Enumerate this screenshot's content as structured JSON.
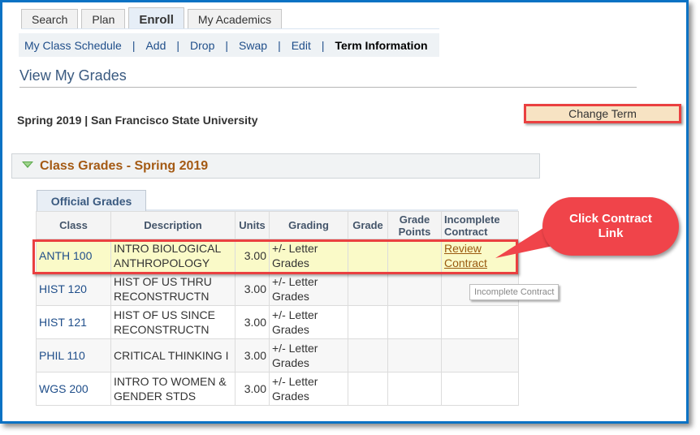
{
  "tabs": [
    {
      "label": "Search",
      "active": false
    },
    {
      "label": "Plan",
      "active": false
    },
    {
      "label": "Enroll",
      "active": true
    },
    {
      "label": "My Academics",
      "active": false
    }
  ],
  "subnav": {
    "items": [
      "My Class Schedule",
      "Add",
      "Drop",
      "Swap",
      "Edit"
    ],
    "separator": "|",
    "current": "Term Information"
  },
  "page_title": "View My Grades",
  "term_line": "Spring 2019 | San Francisco State University",
  "change_term_label": "Change Term",
  "section": {
    "title": "Class Grades - Spring 2019"
  },
  "grid_tab": "Official Grades",
  "table": {
    "headers": [
      "Class",
      "Description",
      "Units",
      "Grading",
      "Grade",
      "Grade Points",
      "Incomplete Contract"
    ],
    "rows": [
      {
        "class": "ANTH 100",
        "description": "INTRO BIOLOGICAL ANTHROPOLOGY",
        "units": "3.00",
        "grading": "+/- Letter Grades",
        "grade": "",
        "grade_points": "",
        "incomplete": "Review Contract"
      },
      {
        "class": "HIST 120",
        "description": "HIST OF US THRU RECONSTRUCTN",
        "units": "3.00",
        "grading": "+/- Letter Grades",
        "grade": "",
        "grade_points": "",
        "incomplete": ""
      },
      {
        "class": "HIST 121",
        "description": "HIST OF US SINCE RECONSTRUCTN",
        "units": "3.00",
        "grading": "+/- Letter Grades",
        "grade": "",
        "grade_points": "",
        "incomplete": ""
      },
      {
        "class": "PHIL 110",
        "description": "CRITICAL THINKING I",
        "units": "3.00",
        "grading": "+/- Letter Grades",
        "grade": "",
        "grade_points": "",
        "incomplete": ""
      },
      {
        "class": "WGS 200",
        "description": "INTRO TO WOMEN & GENDER STDS",
        "units": "3.00",
        "grading": "+/- Letter Grades",
        "grade": "",
        "grade_points": "",
        "incomplete": ""
      }
    ]
  },
  "tooltip": "Incomplete Contract",
  "callout": {
    "text": "Click Contract Link",
    "color": "#f0444a"
  },
  "colors": {
    "frame": "#0b72c4",
    "highlight_border": "#ea4040",
    "link": "#1f4e8a",
    "section_title": "#a45a14"
  }
}
